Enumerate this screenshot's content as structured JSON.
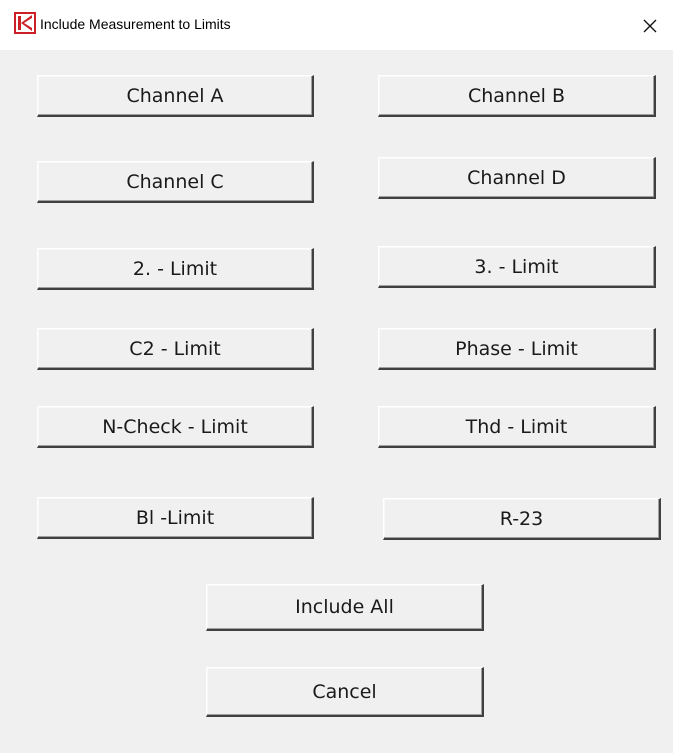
{
  "window": {
    "title": "Include Measurement to Limits",
    "icon": "klippel-k-logo-icon",
    "close_icon": "close-icon"
  },
  "buttons": {
    "channel_a": "Channel A",
    "channel_b": "Channel B",
    "channel_c": "Channel C",
    "channel_d": "Channel D",
    "limit_2": "2. - Limit",
    "limit_3": "3. - Limit",
    "c2_limit": "C2 - Limit",
    "phase_limit": "Phase - Limit",
    "ncheck_limit": "N-Check - Limit",
    "thd_limit": "Thd - Limit",
    "bl_limit": "Bl -Limit",
    "r23": "R-23",
    "include_all": "Include All",
    "cancel": "Cancel"
  },
  "colors": {
    "dialog_background": "#f0f0f0",
    "titlebar_background": "#ffffff",
    "logo_red": "#cc1f26"
  }
}
